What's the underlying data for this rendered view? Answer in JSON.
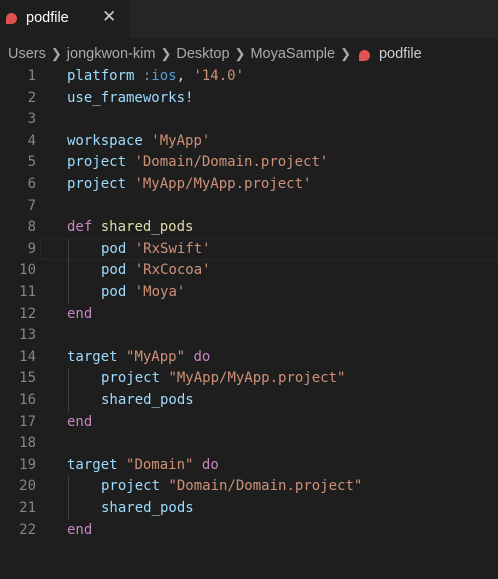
{
  "tab": {
    "label": "podfile",
    "close_glyph": "✕",
    "icon": "ruby-icon"
  },
  "breadcrumb": [
    "Users",
    "jongkwon-kim",
    "Desktop",
    "MoyaSample",
    "podfile"
  ],
  "colors": {
    "keyword": "#c586c0",
    "identifier": "#9cdcfe",
    "string": "#ce9178",
    "symbol": "#569cd6",
    "method": "#dcdcaa",
    "ruby_icon": "#e05252"
  },
  "lines": [
    {
      "n": "1",
      "indent": 0,
      "tokens": [
        {
          "t": "platform",
          "c": "id"
        },
        {
          "t": " ",
          "c": "pun"
        },
        {
          "t": ":ios",
          "c": "sym"
        },
        {
          "t": ", ",
          "c": "pun"
        },
        {
          "t": "'14.0'",
          "c": "str"
        }
      ]
    },
    {
      "n": "2",
      "indent": 0,
      "tokens": [
        {
          "t": "use_frameworks!",
          "c": "id"
        }
      ]
    },
    {
      "n": "3",
      "indent": 0,
      "tokens": []
    },
    {
      "n": "4",
      "indent": 0,
      "tokens": [
        {
          "t": "workspace",
          "c": "id"
        },
        {
          "t": " ",
          "c": "pun"
        },
        {
          "t": "'MyApp'",
          "c": "str"
        }
      ]
    },
    {
      "n": "5",
      "indent": 0,
      "tokens": [
        {
          "t": "project",
          "c": "id"
        },
        {
          "t": " ",
          "c": "pun"
        },
        {
          "t": "'Domain/Domain.project'",
          "c": "str"
        }
      ]
    },
    {
      "n": "6",
      "indent": 0,
      "tokens": [
        {
          "t": "project",
          "c": "id"
        },
        {
          "t": " ",
          "c": "pun"
        },
        {
          "t": "'MyApp/MyApp.project'",
          "c": "str"
        }
      ]
    },
    {
      "n": "7",
      "indent": 0,
      "tokens": []
    },
    {
      "n": "8",
      "indent": 0,
      "tokens": [
        {
          "t": "def",
          "c": "kw"
        },
        {
          "t": " ",
          "c": "pun"
        },
        {
          "t": "shared_pods",
          "c": "meth"
        }
      ]
    },
    {
      "n": "9",
      "indent": 1,
      "current": true,
      "tokens": [
        {
          "t": "pod",
          "c": "id"
        },
        {
          "t": " ",
          "c": "pun"
        },
        {
          "t": "'RxSwift'",
          "c": "str"
        }
      ]
    },
    {
      "n": "10",
      "indent": 1,
      "tokens": [
        {
          "t": "pod",
          "c": "id"
        },
        {
          "t": " ",
          "c": "pun"
        },
        {
          "t": "'RxCocoa'",
          "c": "str"
        }
      ]
    },
    {
      "n": "11",
      "indent": 1,
      "tokens": [
        {
          "t": "pod",
          "c": "id"
        },
        {
          "t": " ",
          "c": "pun"
        },
        {
          "t": "'Moya'",
          "c": "str"
        }
      ]
    },
    {
      "n": "12",
      "indent": 0,
      "tokens": [
        {
          "t": "end",
          "c": "kw"
        }
      ]
    },
    {
      "n": "13",
      "indent": 0,
      "tokens": []
    },
    {
      "n": "14",
      "indent": 0,
      "tokens": [
        {
          "t": "target",
          "c": "id"
        },
        {
          "t": " ",
          "c": "pun"
        },
        {
          "t": "\"MyApp\"",
          "c": "str"
        },
        {
          "t": " ",
          "c": "pun"
        },
        {
          "t": "do",
          "c": "kw"
        }
      ]
    },
    {
      "n": "15",
      "indent": 1,
      "tokens": [
        {
          "t": "project",
          "c": "id"
        },
        {
          "t": " ",
          "c": "pun"
        },
        {
          "t": "\"MyApp/MyApp.project\"",
          "c": "str"
        }
      ]
    },
    {
      "n": "16",
      "indent": 1,
      "tokens": [
        {
          "t": "shared_pods",
          "c": "id"
        }
      ]
    },
    {
      "n": "17",
      "indent": 0,
      "tokens": [
        {
          "t": "end",
          "c": "kw"
        }
      ]
    },
    {
      "n": "18",
      "indent": 0,
      "tokens": []
    },
    {
      "n": "19",
      "indent": 0,
      "tokens": [
        {
          "t": "target",
          "c": "id"
        },
        {
          "t": " ",
          "c": "pun"
        },
        {
          "t": "\"Domain\"",
          "c": "str"
        },
        {
          "t": " ",
          "c": "pun"
        },
        {
          "t": "do",
          "c": "kw"
        }
      ]
    },
    {
      "n": "20",
      "indent": 1,
      "tokens": [
        {
          "t": "project",
          "c": "id"
        },
        {
          "t": " ",
          "c": "pun"
        },
        {
          "t": "\"Domain/Domain.project\"",
          "c": "str"
        }
      ]
    },
    {
      "n": "21",
      "indent": 1,
      "tokens": [
        {
          "t": "shared_pods",
          "c": "id"
        }
      ]
    },
    {
      "n": "22",
      "indent": 0,
      "tokens": [
        {
          "t": "end",
          "c": "kw"
        }
      ]
    }
  ]
}
